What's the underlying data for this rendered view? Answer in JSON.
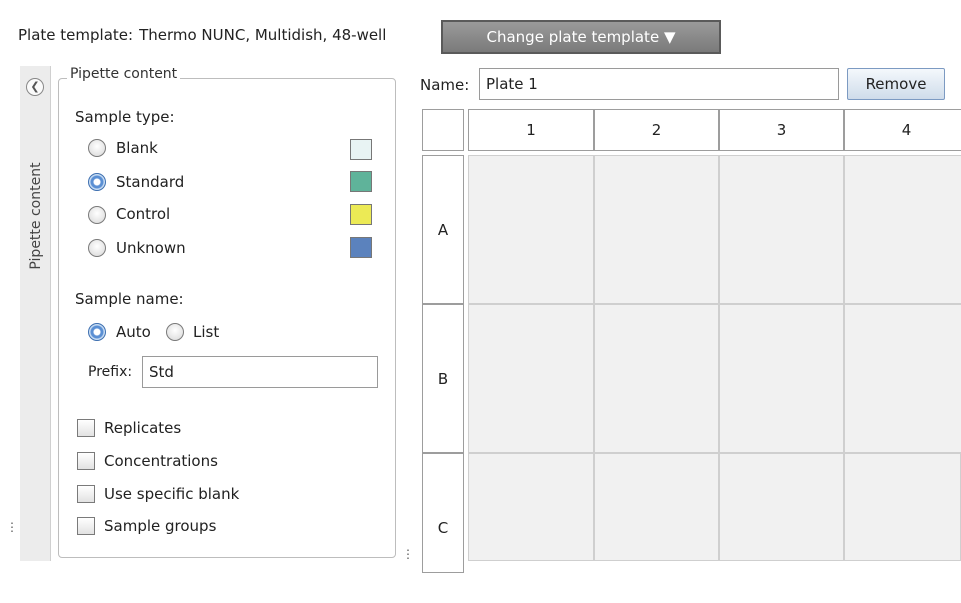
{
  "plate_template": {
    "label": "Plate template:",
    "value": "Thermo NUNC, Multidish, 48-well"
  },
  "change_button": {
    "label": "Change plate template",
    "icon": "caret-down-icon"
  },
  "side_tab": {
    "label": "Pipette content",
    "collapse_icon": "chevron-left-circle-icon"
  },
  "pipette": {
    "title": "Pipette content",
    "sample_type_label": "Sample type:",
    "sample_types": [
      {
        "label": "Blank",
        "selected": false,
        "color": "#e8f3f3"
      },
      {
        "label": "Standard",
        "selected": true,
        "color": "#5fb39a"
      },
      {
        "label": "Control",
        "selected": false,
        "color": "#ecea55"
      },
      {
        "label": "Unknown",
        "selected": false,
        "color": "#5b82bd"
      }
    ],
    "sample_name_label": "Sample name:",
    "name_modes": [
      {
        "label": "Auto",
        "selected": true
      },
      {
        "label": "List",
        "selected": false
      }
    ],
    "prefix_label": "Prefix:",
    "prefix_value": "Std",
    "options": [
      {
        "label": "Replicates",
        "checked": false
      },
      {
        "label": "Concentrations",
        "checked": false
      },
      {
        "label": "Use specific blank",
        "checked": false
      },
      {
        "label": "Sample groups",
        "checked": false
      }
    ]
  },
  "plate": {
    "name_label": "Name:",
    "name_value": "Plate 1",
    "remove_label": "Remove",
    "columns": [
      "1",
      "2",
      "3",
      "4"
    ],
    "rows": [
      "A",
      "B",
      "C"
    ]
  }
}
